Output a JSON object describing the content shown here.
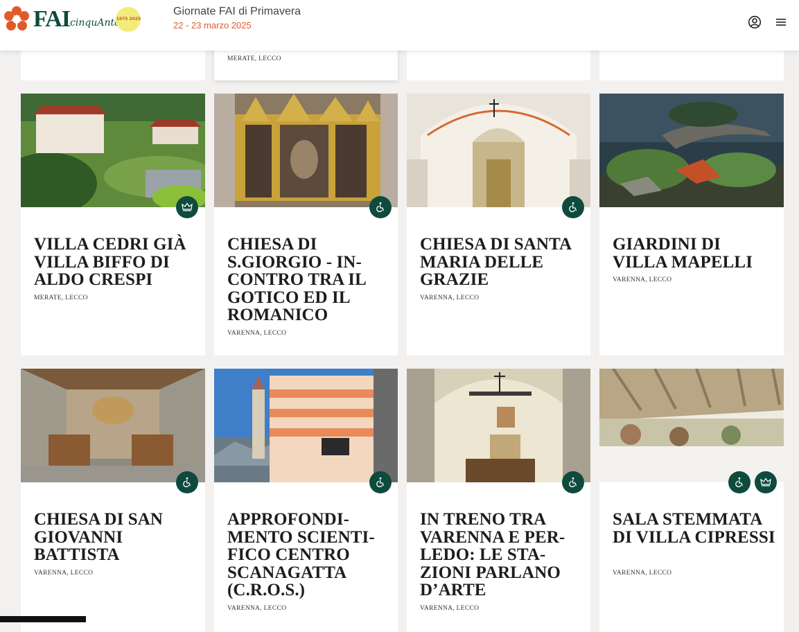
{
  "header": {
    "logo_text": "FAI",
    "logo_subtext": "cinquAnta",
    "logo_badge_text": "1975 2025",
    "event_title": "Giornate FAI di Primavera",
    "event_dates": "22 - 23 marzo 2025",
    "account_icon": "user-circle-icon",
    "menu_icon": "hamburger-menu-icon"
  },
  "colors": {
    "brand_green": "#0e4a3e",
    "accent_orange": "#e25a2a",
    "page_bg": "#f2f1ef"
  },
  "top_row": {
    "partial_location": "MERATE, LECCO"
  },
  "cards": [
    {
      "title": "VILLA CEDRI GIÀ VILLA BIFFO DI ALDO CRESPI",
      "location": "MERATE, LECCO",
      "badges": [
        "crown-icon"
      ]
    },
    {
      "title": "CHIESA DI S.GIORGIO - IN-CONTRO TRA IL GOTICO ED IL ROMANICO",
      "location": "VARENNA, LECCO",
      "badges": [
        "wheelchair-icon"
      ]
    },
    {
      "title": "CHIESA DI SANTA MARIA DELLE GRAZIE",
      "location": "VARENNA, LECCO",
      "badges": [
        "wheelchair-icon"
      ]
    },
    {
      "title": "GIARDINI DI VILLA MAPELLI",
      "location": "VARENNA, LECCO",
      "badges": []
    },
    {
      "title": "CHIESA DI SAN GIOVANNI BATTISTA",
      "location": "VARENNA, LECCO",
      "badges": [
        "wheelchair-icon"
      ]
    },
    {
      "title": "APPROFONDI-MENTO SCIENTI-FICO CENTRO SCANAGATTA (C.R.O.S.)",
      "location": "VARENNA, LECCO",
      "badges": [
        "wheelchair-icon"
      ]
    },
    {
      "title": "IN TRENO TRA VARENNA E PER-LEDO: LE STA-ZIONI PARLANO D’ARTE",
      "location": "VARENNA, LECCO",
      "badges": [
        "wheelchair-icon"
      ]
    },
    {
      "title": "SALA STEMMATA DI VILLA CIPRESSI",
      "location": "VARENNA, LECCO",
      "badges": [
        "wheelchair-icon",
        "crown-icon"
      ]
    }
  ]
}
